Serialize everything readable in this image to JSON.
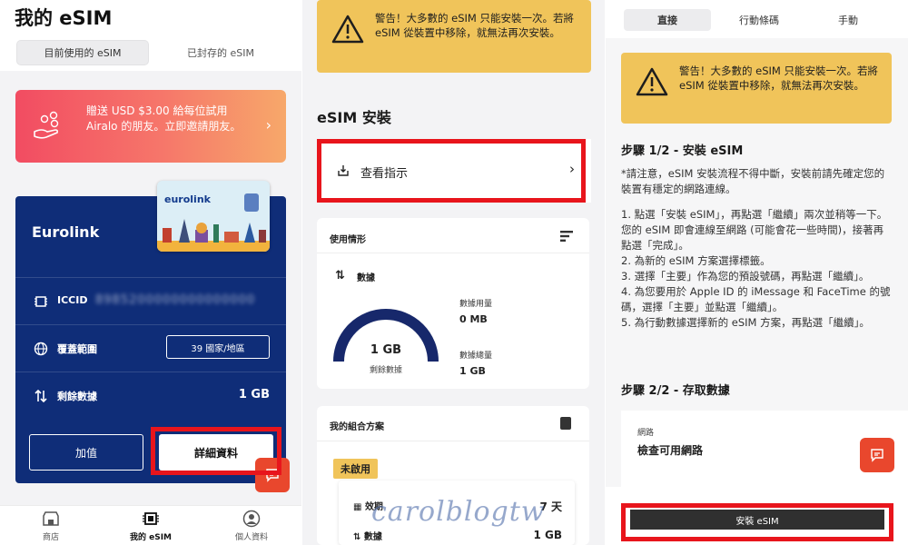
{
  "panel1": {
    "app_title": "我的 eSIM",
    "tabs": [
      "目前使用的 eSIM",
      "已封存的 eSIM"
    ],
    "promo_text": "贈送 USD $3.00 給每位試用 Airalo 的朋友。立即邀請朋友。",
    "card": {
      "name": "Eurolink",
      "sim_brand": "eurolink",
      "iccid_label": "ICCID",
      "iccid_value": "8985200000000000000",
      "coverage_label": "覆蓋範圍",
      "coverage_value": "39 國家/地區",
      "remaining_label": "剩餘數據",
      "remaining_value": "1 GB",
      "topup_label": "加值",
      "details_label": "詳細資料"
    },
    "nav": [
      "商店",
      "我的 eSIM",
      "個人資料"
    ]
  },
  "panel2": {
    "warning": "警告！大多數的 eSIM 只能安裝一次。若將 eSIM 從裝置中移除，就無法再次安裝。",
    "install_title": "eSIM 安裝",
    "view_guide": "查看指示",
    "usage": {
      "title": "使用情形",
      "data_label": "數據",
      "remaining_value": "1 GB",
      "remaining_label": "剩餘數據",
      "used_label": "數據用量",
      "used_value": "0 MB",
      "total_label": "數據總量",
      "total_value": "1 GB",
      "remaining_fraction": 1.0
    },
    "combo": {
      "title": "我的組合方案",
      "status_badge": "未啟用",
      "validity_label": "效期",
      "validity_value": "7 天",
      "data_label": "數據",
      "data_value": "1 GB"
    },
    "watermark": "carolblogtw"
  },
  "panel3": {
    "tabs": [
      "直接",
      "行動條碼",
      "手動"
    ],
    "warning": "警告！大多數的 eSIM 只能安裝一次。若將 eSIM 從裝置中移除，就無法再次安裝。",
    "step1_title": "步驟 1/2 - 安裝 eSIM",
    "step1_note": "*請注意，eSIM 安裝流程不得中斷，安裝前請先確定您的裝置有穩定的網路連線。",
    "step1_list": "1. 點選「安裝 eSIM」，再點選「繼續」兩次並稍等一下。您的 eSIM 即會連線至網路 (可能會花一些時間)，接著再點選「完成」。\n2. 為新的 eSIM 方案選擇標籤。\n3. 選擇「主要」作為您的預設號碼，再點選「繼續」。\n4. 為您要用於 Apple ID 的 iMessage 和 FaceTime 的號碼，選擇「主要」並點選「繼續」。\n5. 為行動數據選擇新的 eSIM 方案，再點選「繼續」。",
    "step2_title": "步驟 2/2 - 存取數據",
    "network_label": "網路",
    "network_value": "檢查可用網路",
    "install_button": "安裝 eSIM"
  },
  "colors": {
    "card_blue": "#0f2d78",
    "warning_yellow": "#f0c45a",
    "highlight_red": "#e8151c",
    "fab_orange": "#e9472d"
  },
  "icons": [
    "gift-hand-icon",
    "chip-icon",
    "globe-icon",
    "updown-arrows-icon",
    "store-icon",
    "esim-icon",
    "profile-icon",
    "warning-triangle-icon",
    "install-icon",
    "chevron-right-icon",
    "chat-icon",
    "bars-icon",
    "layers-icon"
  ]
}
